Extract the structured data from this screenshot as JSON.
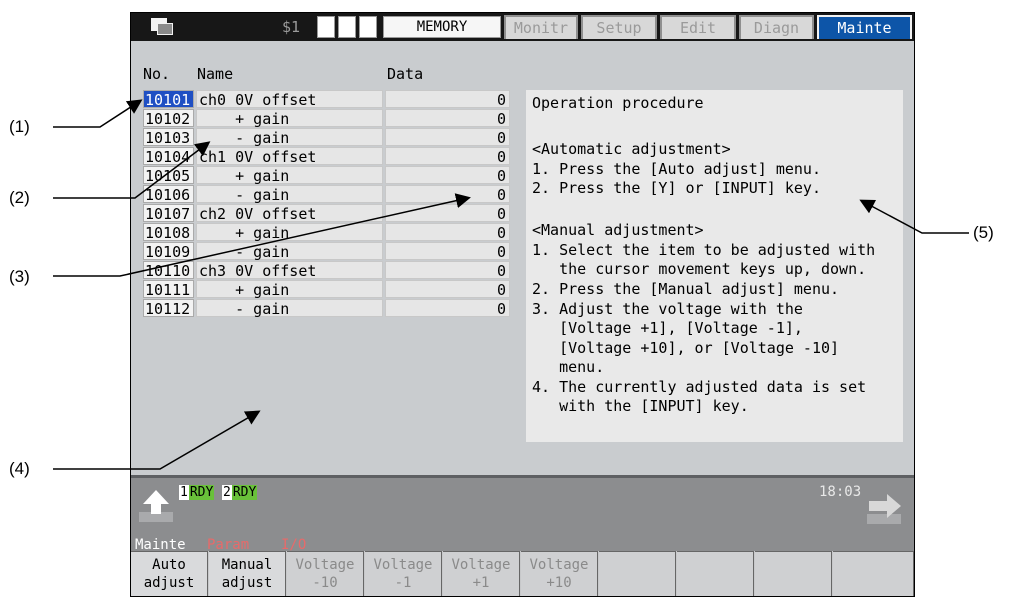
{
  "callouts": [
    "(1)",
    "(2)",
    "(3)",
    "(4)",
    "(5)"
  ],
  "topbar": {
    "system": "$1",
    "mode": "MEMORY",
    "tabs": [
      {
        "label": "Monitr",
        "active": false
      },
      {
        "label": "Setup",
        "active": false
      },
      {
        "label": "Edit",
        "active": false
      },
      {
        "label": "Diagn",
        "active": false
      },
      {
        "label": "Mainte",
        "active": true
      }
    ]
  },
  "table": {
    "headers": {
      "no": "No.",
      "name": "Name",
      "data": "Data"
    },
    "rows": [
      {
        "no": "10101",
        "name": "ch0 0V offset",
        "data": "0",
        "selected": true
      },
      {
        "no": "10102",
        "name": "    + gain",
        "data": "0"
      },
      {
        "no": "10103",
        "name": "    - gain",
        "data": "0"
      },
      {
        "no": "10104",
        "name": "ch1 0V offset",
        "data": "0"
      },
      {
        "no": "10105",
        "name": "    + gain",
        "data": "0"
      },
      {
        "no": "10106",
        "name": "    - gain",
        "data": "0"
      },
      {
        "no": "10107",
        "name": "ch2 0V offset",
        "data": "0"
      },
      {
        "no": "10108",
        "name": "    + gain",
        "data": "0"
      },
      {
        "no": "10109",
        "name": "    - gain",
        "data": "0"
      },
      {
        "no": "10110",
        "name": "ch3 0V offset",
        "data": "0"
      },
      {
        "no": "10111",
        "name": "    + gain",
        "data": "0"
      },
      {
        "no": "10112",
        "name": "    - gain",
        "data": "0"
      }
    ]
  },
  "guide": {
    "lines": [
      "Operation procedure",
      "",
      "<Automatic adjustment>",
      "1. Press the [Auto adjust] menu.",
      "2. Press the [Y] or [INPUT] key.",
      "",
      "<Manual adjustment>",
      "1. Select the item to be adjusted with",
      "   the cursor movement keys up, down.",
      "2. Press the [Manual adjust] menu.",
      "3. Adjust the voltage with the",
      "   [Voltage +1], [Voltage -1],",
      "   [Voltage +10], or [Voltage -10]",
      "   menu.",
      "4. The currently adjusted data is set",
      "   with the [INPUT] key."
    ]
  },
  "status": {
    "rdy1_num": "1",
    "rdy1": "RDY",
    "rdy2_num": "2",
    "rdy2": "RDY",
    "time": "18:03"
  },
  "menu_path": {
    "current": "Mainte",
    "items": [
      "Param",
      "I/O"
    ]
  },
  "softkeys": [
    {
      "label": "Auto\nadjust",
      "enabled": true
    },
    {
      "label": "Manual\nadjust",
      "enabled": true
    },
    {
      "label": "Voltage\n-10",
      "enabled": false
    },
    {
      "label": "Voltage\n-1",
      "enabled": false
    },
    {
      "label": "Voltage\n+1",
      "enabled": false
    },
    {
      "label": "Voltage\n+10",
      "enabled": false
    },
    {
      "label": "",
      "enabled": false
    },
    {
      "label": "",
      "enabled": false
    },
    {
      "label": "",
      "enabled": false
    },
    {
      "label": "",
      "enabled": false
    }
  ],
  "colors": {
    "active_tab": "#0d55a8",
    "selected_cell": "#1f4fc3",
    "rdy": "#69c13a",
    "menu_path": "#e86a6a"
  }
}
